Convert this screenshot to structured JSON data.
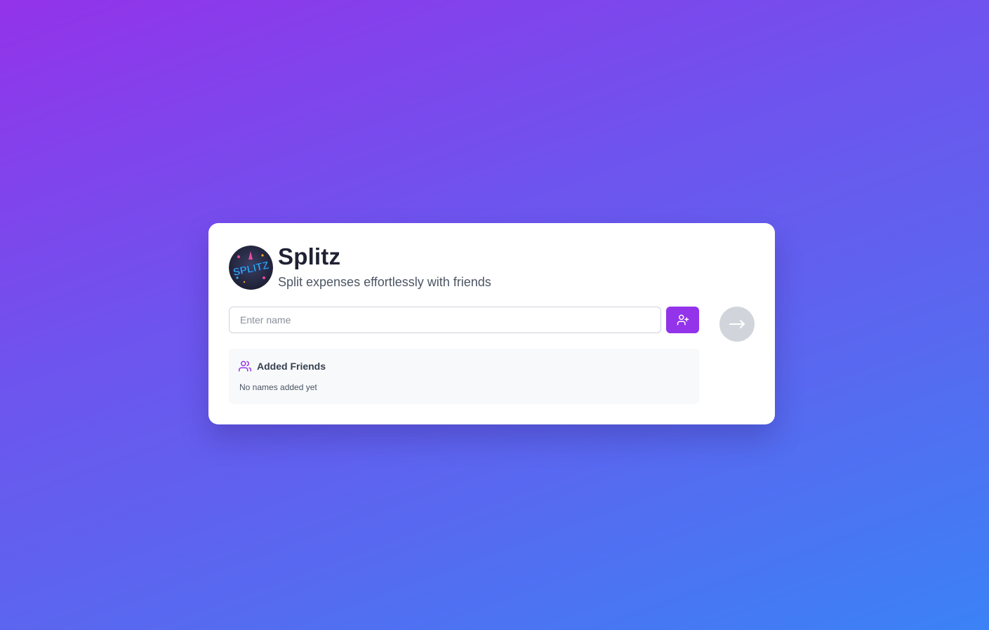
{
  "app": {
    "title": "Splitz",
    "subtitle": "Split expenses effortlessly with friends",
    "logo_text": "SPLITZ"
  },
  "form": {
    "name_placeholder": "Enter name",
    "add_button_icon": "user-plus-icon",
    "next_button_icon": "arrow-right-icon"
  },
  "friends": {
    "title": "Added Friends",
    "icon": "users-icon",
    "empty_message": "No names added yet",
    "items": []
  },
  "colors": {
    "accent": "#9333ea",
    "next_disabled": "#d1d5db",
    "background_start": "#9333ea",
    "background_end": "#3b82f6"
  }
}
